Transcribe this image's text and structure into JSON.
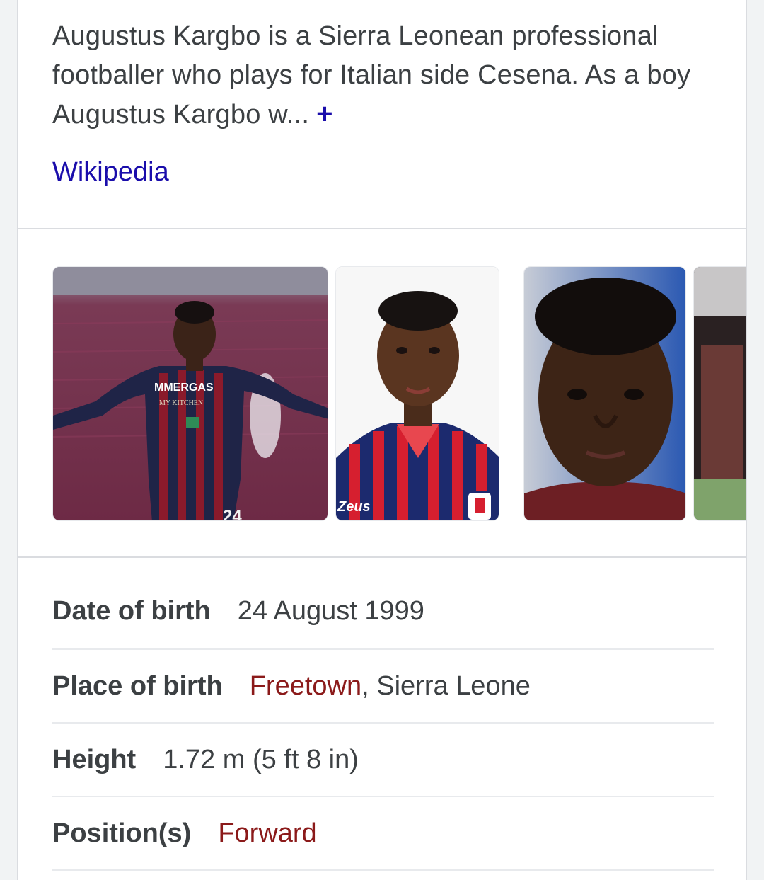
{
  "description": {
    "text": "Augustus Kargbo is a Sierra Leonean professional footballer who plays for Italian side Cesena. As a boy Augustus Kargbo w...",
    "expand_symbol": "+",
    "source": "Wikipedia"
  },
  "gallery": {
    "images": [
      {
        "alt": "Augustus Kargbo celebrating in Reggiana kit",
        "kit_text": "MMERGAS",
        "kit_subtext": "MY KITCHEN",
        "number": "24"
      },
      {
        "alt": "Augustus Kargbo headshot in Crotone kit",
        "kit_text": "Zeus"
      },
      {
        "alt": "Augustus Kargbo close-up portrait"
      },
      {
        "alt": "Augustus Kargbo in action"
      }
    ]
  },
  "facts": [
    {
      "label": "Date of birth",
      "value": "24 August 1999"
    },
    {
      "label": "Place of birth",
      "link": "Freetown",
      "value": ", Sierra Leone"
    },
    {
      "label": "Height",
      "value": "1.72 m (5 ft 8 in)"
    },
    {
      "label": "Position(s)",
      "link": "Forward",
      "value": ""
    }
  ],
  "colors": {
    "link_blue": "#1a0dab",
    "entity_link": "#8b1a1a",
    "text": "#3c4043",
    "divider": "#dadce0"
  }
}
